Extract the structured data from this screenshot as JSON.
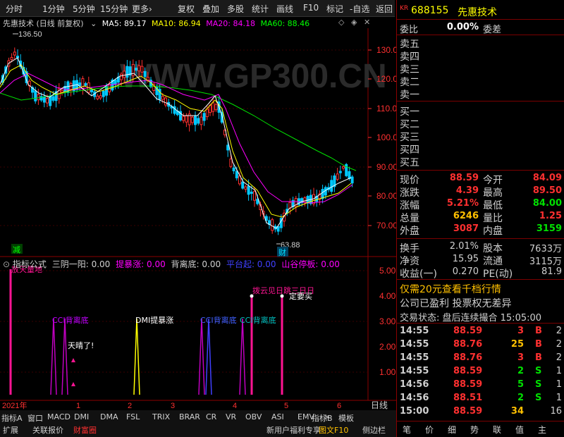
{
  "toolbar": {
    "tabs": [
      "分时",
      "1分钟",
      "5分钟",
      "15分钟",
      "更多›"
    ],
    "tools": [
      "复权",
      "叠加",
      "多股",
      "统计",
      "画线",
      "F10",
      "标记",
      "-自选",
      "返回"
    ]
  },
  "main_chart": {
    "title": "先惠技术 (日线 前复权)",
    "ma": [
      {
        "label": "MA5: 89.17",
        "color": "#ffffff"
      },
      {
        "label": "MA10: 86.94",
        "color": "#ffff00"
      },
      {
        "label": "MA20: 84.18",
        "color": "#ff00ff"
      },
      {
        "label": "MA60: 88.46",
        "color": "#00ff00"
      }
    ],
    "watermark": "WWW.GP300.CN",
    "high_label": "136.50",
    "low_label": "63.88",
    "y_ticks": [
      "130.0",
      "120.0",
      "110.0",
      "100.0",
      "90.00",
      "80.00",
      "70.00"
    ],
    "marker_jian": "减",
    "marker_cai": "财"
  },
  "indicator": {
    "name": "指标公式",
    "items": [
      {
        "label": "三阴一阳: 0.00",
        "color": "#d0d0d0"
      },
      {
        "label": "提暴涨: 0.00",
        "color": "#ff00ff"
      },
      {
        "label": "背离底: 0.00",
        "color": "#d0d0d0"
      },
      {
        "label": "平台起: 0.00",
        "color": "#4040ff"
      },
      {
        "label": "山谷停板: 0.00",
        "color": "#ff00ff"
      }
    ],
    "top_label": "放天量地",
    "y_ticks": [
      "5.00",
      "4.00",
      "3.00",
      "2.00",
      "1.00"
    ],
    "labels": [
      "CCI背离底",
      "DMI提暴涨",
      "CCI背离底",
      "CCI背离底",
      "天晴了!",
      "拨云见日跳三日日",
      "定要买"
    ]
  },
  "x_axis": {
    "labels": [
      "2021年",
      "1",
      "2",
      "3",
      "4",
      "5",
      "6"
    ],
    "right_label": "日线"
  },
  "bottom_tabs": {
    "row1": [
      "指标A",
      "窗口",
      "MACD",
      "DMI",
      "DMA",
      "FSL",
      "TRIX",
      "BRAR",
      "CR",
      "VR",
      "OBV",
      "ASI",
      "EMV",
      ">"
    ],
    "row1_right": [
      "指标B",
      "模板"
    ],
    "row2": [
      "扩展",
      "关联报价",
      "财富圈"
    ],
    "row2_right": [
      "新用户福利专享",
      "图文F10",
      "侧边栏"
    ]
  },
  "quote": {
    "code": "688155",
    "name": "先惠技术",
    "kr": "KR",
    "weibi_label": "委比",
    "weibi": "0.00%",
    "weicha_label": "委差",
    "weicha": "",
    "sells": [
      "卖五",
      "卖四",
      "卖三",
      "卖二",
      "卖一"
    ],
    "buys": [
      "买一",
      "买二",
      "买三",
      "买四",
      "买五"
    ],
    "stats": [
      [
        "现价",
        "88.59",
        "今开",
        "84.09"
      ],
      [
        "涨跌",
        "4.39",
        "最高",
        "89.50"
      ],
      [
        "涨幅",
        "5.21%",
        "最低",
        "84.00"
      ],
      [
        "总量",
        "6246",
        "量比",
        "1.25"
      ],
      [
        "外盘",
        "3087",
        "内盘",
        "3159"
      ]
    ],
    "stats2": [
      [
        "换手",
        "2.01%",
        "股本",
        "7633万"
      ],
      [
        "净资",
        "15.95",
        "流通",
        "3115万"
      ],
      [
        "收益(一)",
        "0.270",
        "PE(动)",
        "81.9"
      ]
    ],
    "promo": "仅需20元查看千档行情",
    "notice": "公司已盈利 投票权无差异",
    "status": "交易状态: 盘后连续撮合 15:05:00",
    "ticks": [
      [
        "14:55",
        "88.59",
        "3",
        "B",
        "2"
      ],
      [
        "14:55",
        "88.76",
        "25",
        "B",
        "2"
      ],
      [
        "14:55",
        "88.76",
        "3",
        "B",
        "2"
      ],
      [
        "14:55",
        "88.59",
        "2",
        "S",
        "1"
      ],
      [
        "14:56",
        "88.59",
        "5",
        "S",
        "1"
      ],
      [
        "14:56",
        "88.51",
        "2",
        "S",
        "1"
      ],
      [
        "15:00",
        "88.59",
        "34",
        "",
        "16"
      ]
    ],
    "bottom_tabs": [
      "笔",
      "价",
      "细",
      "势",
      "联",
      "值",
      "主"
    ]
  }
}
